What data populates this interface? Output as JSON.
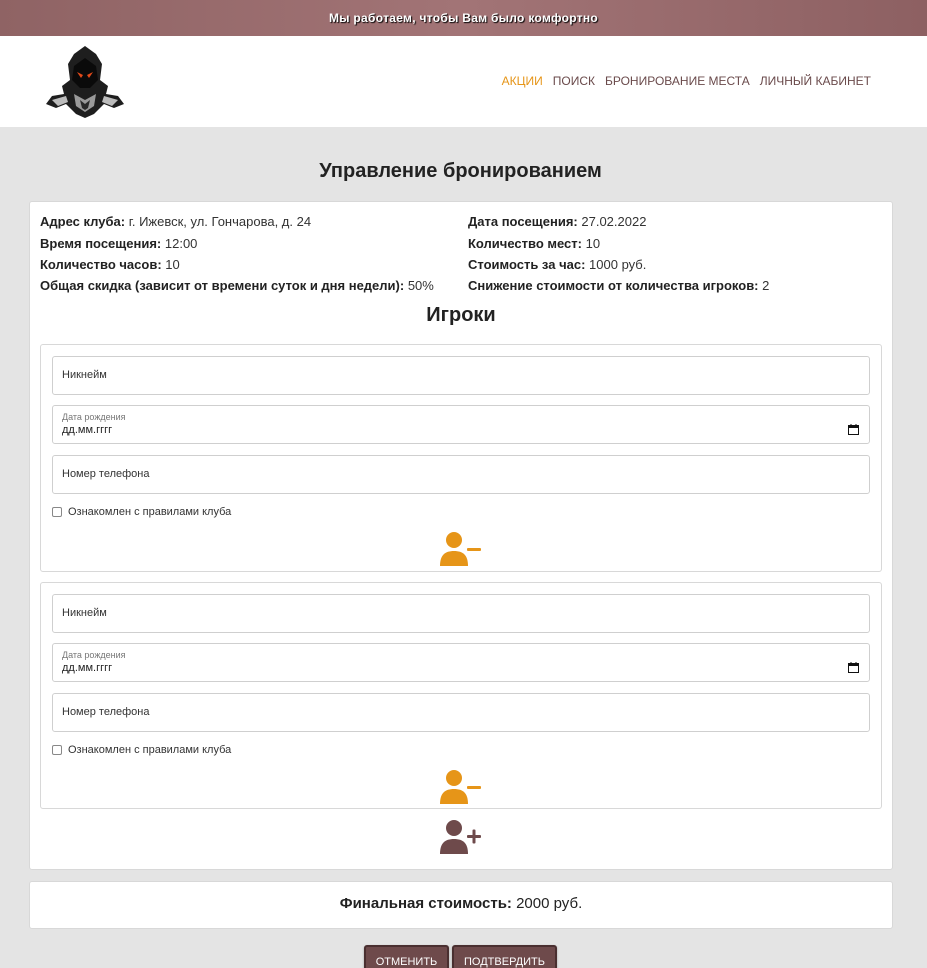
{
  "topbar": {
    "text": "Мы работаем, чтобы Вам было комфортно"
  },
  "nav": {
    "items": [
      "АКЦИИ",
      "ПОИСК",
      "БРОНИРОВАНИЕ МЕСТА",
      "ЛИЧНЫЙ КАБИНЕТ"
    ],
    "active_color": "#e69518",
    "color": "#6a4a4b"
  },
  "page": {
    "title": "Управление бронированием"
  },
  "booking": {
    "address_label": "Адрес клуба:",
    "address_value": "г. Ижевск, ул. Гончарова, д. 24",
    "date_label": "Дата посещения:",
    "date_value": "27.02.2022",
    "time_label": "Время посещения:",
    "time_value": "12:00",
    "places_label": "Количество мест:",
    "places_value": "10",
    "hours_label": "Количество часов:",
    "hours_value": "10",
    "price_label": "Стоимость за час:",
    "price_value": "1000 руб.",
    "discount_label": "Общая скидка (зависит от времени суток и дня недели):",
    "discount_value": "50%",
    "reduction_label": "Снижение стоимости от количества игроков:",
    "reduction_value": "2"
  },
  "players": {
    "title": "Игроки",
    "list": [
      {
        "nickname_placeholder": "Никнейм",
        "birth_label": "Дата рождения",
        "birth_value": "дд.мм.гггг",
        "phone_placeholder": "Номер телефона",
        "rules_label": "Ознакомлен с правилами клуба"
      },
      {
        "nickname_placeholder": "Никнейм",
        "birth_label": "Дата рождения",
        "birth_value": "дд.мм.гггг",
        "phone_placeholder": "Номер телефона",
        "rules_label": "Ознакомлен с правилами клуба"
      }
    ],
    "remove_icon": "user-minus-icon",
    "add_icon": "user-plus-icon",
    "remove_color": "#e69518",
    "add_color": "#6e4a4b"
  },
  "final": {
    "label": "Финальная стоимость:",
    "value": "2000 руб."
  },
  "buttons": {
    "cancel": "Отменить",
    "confirm": "Подтвердить"
  }
}
